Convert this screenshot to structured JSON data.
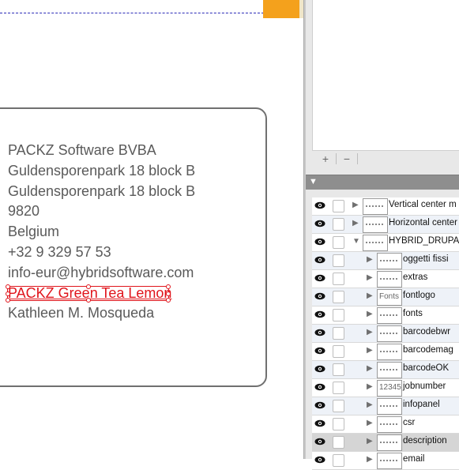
{
  "address": {
    "company": "PACKZ Software BVBA",
    "street1": "Guldensporenpark 18 block B",
    "street2": "Guldensporenpark 18 block B",
    "zip": "9820",
    "country": "Belgium",
    "phone": "+32 9 329 57 53",
    "email": "info-eur@hybridsoftware.com",
    "selected_line": "PACKZ Green Tea Lemon",
    "name": "Kathleen M. Mosqueda"
  },
  "panel": {
    "add_label": "+",
    "remove_label": "−",
    "header_icon": "▼"
  },
  "layers": [
    {
      "name": "Vertical center m",
      "thumb": "",
      "indent": 0
    },
    {
      "name": "Horizontal center",
      "thumb": "",
      "indent": 0
    },
    {
      "name": "HYBRID_DRUPA_",
      "thumb": "",
      "indent": 0,
      "expanded": true
    },
    {
      "name": "oggetti fissi",
      "thumb": "",
      "indent": 1
    },
    {
      "name": "extras",
      "thumb": "",
      "indent": 1
    },
    {
      "name": "fontlogo",
      "thumb": "Fonts",
      "indent": 1
    },
    {
      "name": "fonts",
      "thumb": "",
      "indent": 1
    },
    {
      "name": "barcodebwr",
      "thumb": "",
      "indent": 1
    },
    {
      "name": "barcodemag",
      "thumb": "",
      "indent": 1
    },
    {
      "name": "barcodeOK",
      "thumb": "",
      "indent": 1
    },
    {
      "name": "jobnumber",
      "thumb": "12345",
      "indent": 1
    },
    {
      "name": "infopanel",
      "thumb": "",
      "indent": 1
    },
    {
      "name": "csr",
      "thumb": "",
      "indent": 1
    },
    {
      "name": "description",
      "thumb": "",
      "indent": 1,
      "selected": true
    },
    {
      "name": "email",
      "thumb": "",
      "indent": 1
    }
  ],
  "colors": {
    "selection": "#e0141b",
    "guide": "#2b2bb8",
    "accent_orange": "#f4a11c"
  },
  "icons": {
    "eye": "eye-icon",
    "lock": "lock-toggle",
    "expand": "disclosure-triangle-icon"
  }
}
